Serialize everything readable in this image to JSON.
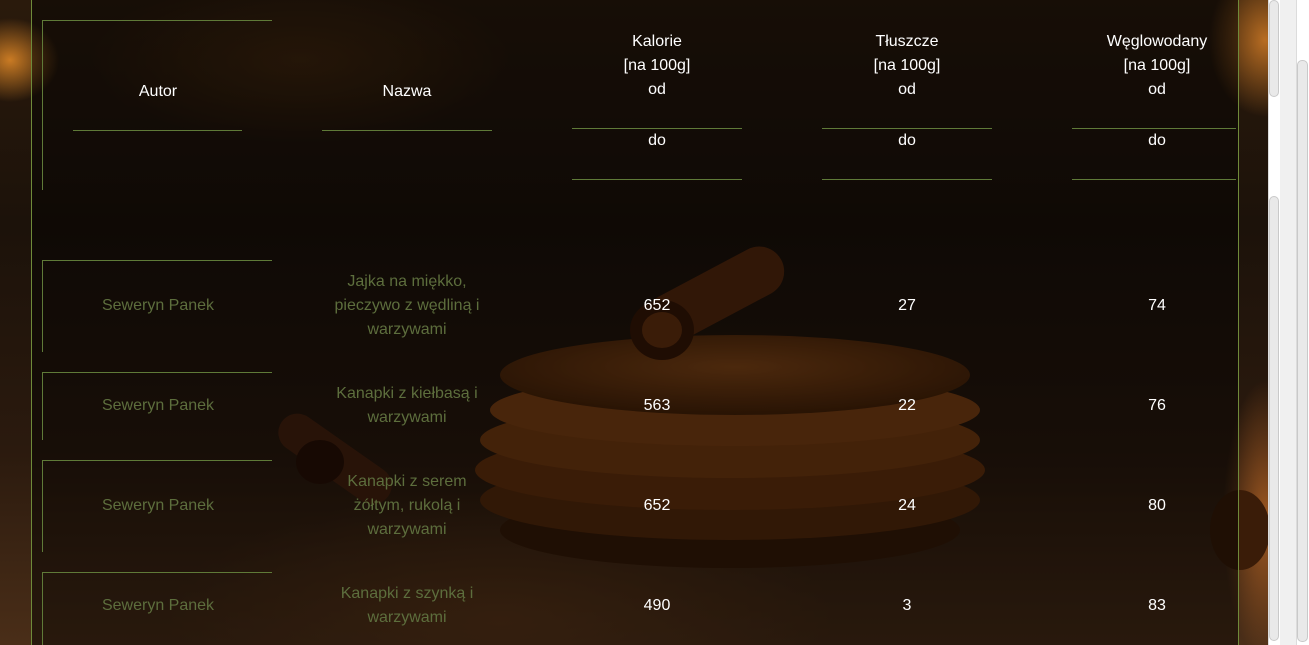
{
  "table": {
    "headers": {
      "autor": "Autor",
      "nazwa": "Nazwa",
      "kalorie": [
        "Kalorie",
        "[na 100g]",
        "od"
      ],
      "tluszcze": [
        "Tłuszcze",
        "[na 100g]",
        "od"
      ],
      "weglowodany": [
        "Węglowodany",
        "[na 100g]",
        "od"
      ],
      "do_label": "do"
    },
    "rows": [
      {
        "autor": "Seweryn Panek",
        "nazwa": [
          "Jajka na miękko,",
          "pieczywo z wędliną i",
          "warzywami"
        ],
        "kalorie": "652",
        "tluszcze": "27",
        "weglowodany": "74"
      },
      {
        "autor": "Seweryn Panek",
        "nazwa": [
          "Kanapki z kiełbasą i",
          "warzywami"
        ],
        "kalorie": "563",
        "tluszcze": "22",
        "weglowodany": "76"
      },
      {
        "autor": "Seweryn Panek",
        "nazwa": [
          "Kanapki z serem",
          "żółtym, rukolą i",
          "warzywami"
        ],
        "kalorie": "652",
        "tluszcze": "24",
        "weglowodany": "80"
      },
      {
        "autor": "Seweryn Panek",
        "nazwa": [
          "Kanapki z szynką i",
          "warzywami"
        ],
        "kalorie": "490",
        "tluszcze": "3",
        "weglowodany": "83"
      }
    ]
  },
  "colors": {
    "border_accent": "#6f8a3a",
    "link_text": "#5d6e3d",
    "header_text": "#ffffff"
  }
}
